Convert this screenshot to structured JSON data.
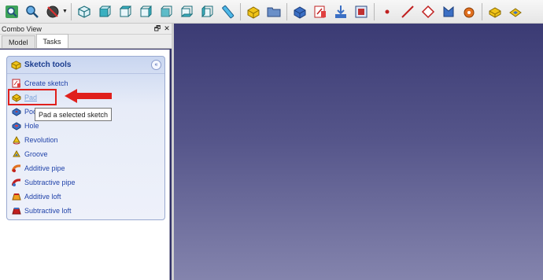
{
  "toolbar": {
    "buttons": [
      {
        "icon": "fit-all-icon"
      },
      {
        "icon": "fit-selection-icon"
      },
      {
        "icon": "draw-style-icon"
      },
      {
        "icon": "isometric-view-icon"
      },
      {
        "icon": "front-view-icon"
      },
      {
        "icon": "top-view-icon"
      },
      {
        "icon": "right-view-icon"
      },
      {
        "icon": "rear-view-icon"
      },
      {
        "icon": "bottom-view-icon"
      },
      {
        "icon": "left-view-icon"
      },
      {
        "icon": "measure-icon"
      },
      {
        "icon": "part-icon"
      },
      {
        "icon": "group-folder-icon"
      },
      {
        "icon": "body-icon"
      },
      {
        "icon": "sketch-icon"
      },
      {
        "icon": "import-icon"
      },
      {
        "icon": "shape-binder-icon"
      },
      {
        "icon": "datum-point-icon"
      },
      {
        "icon": "datum-line-icon"
      },
      {
        "icon": "datum-plane-icon"
      },
      {
        "icon": "local-coordinate-icon"
      },
      {
        "icon": "clone-icon"
      },
      {
        "icon": "pad-toolbar-icon"
      },
      {
        "icon": "pocket-toolbar-icon"
      }
    ]
  },
  "combo_view": {
    "title": "Combo View",
    "float_symbol": "🗗",
    "close_symbol": "✕",
    "tabs": [
      {
        "label": "Model"
      },
      {
        "label": "Tasks"
      }
    ]
  },
  "sketch_tools": {
    "title": "Sketch tools",
    "collapse_symbol": "«",
    "items": [
      {
        "label": "Create sketch",
        "icon": "create-sketch-icon"
      },
      {
        "label": "Pad",
        "icon": "pad-icon"
      },
      {
        "label": "Pocket",
        "icon": "pocket-icon"
      },
      {
        "label": "Hole",
        "icon": "hole-icon"
      },
      {
        "label": "Revolution",
        "icon": "revolution-icon"
      },
      {
        "label": "Groove",
        "icon": "groove-icon"
      },
      {
        "label": "Additive pipe",
        "icon": "additive-pipe-icon"
      },
      {
        "label": "Subtractive pipe",
        "icon": "subtractive-pipe-icon"
      },
      {
        "label": "Additive loft",
        "icon": "additive-loft-icon"
      },
      {
        "label": "Subtractive loft",
        "icon": "subtractive-loft-icon"
      }
    ]
  },
  "tooltip": {
    "text": "Pad a selected sketch"
  },
  "colors": {
    "highlight": "#e0201c",
    "panel_bg": "#2f2f66",
    "view_top": "#3b3b74",
    "view_bottom": "#8484ad",
    "link": "#2244aa"
  }
}
